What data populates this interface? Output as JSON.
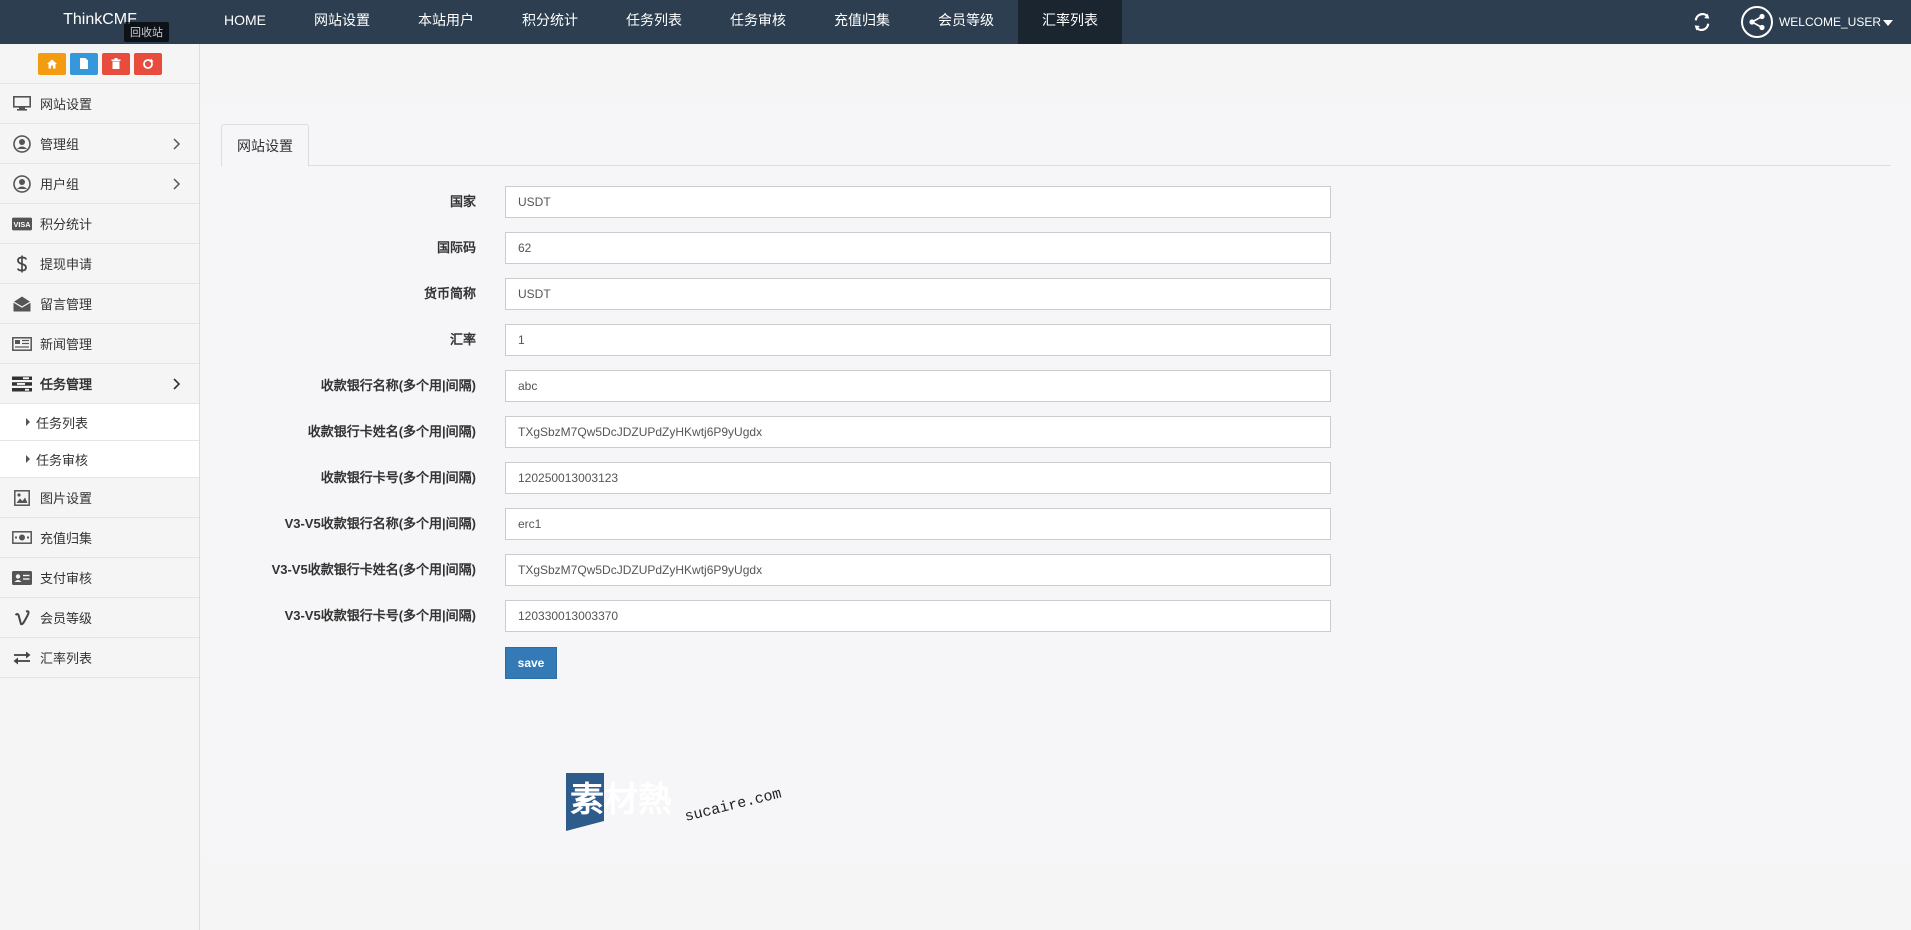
{
  "brand": "ThinkCMF",
  "nav": {
    "items": [
      "HOME",
      "网站设置",
      "本站用户",
      "积分统计",
      "任务列表",
      "任务审核",
      "充值归集",
      "会员等级",
      "汇率列表"
    ],
    "active_index": 8,
    "welcome": "WELCOME_USER"
  },
  "shortcuts": {
    "tooltip": "回收站"
  },
  "sidebar": {
    "items": [
      {
        "label": "网站设置",
        "icon": "monitor-icon"
      },
      {
        "label": "管理组",
        "icon": "user-circle-icon",
        "has_children": true
      },
      {
        "label": "用户组",
        "icon": "user-icon",
        "has_children": true
      },
      {
        "label": "积分统计",
        "icon": "visa-card-icon"
      },
      {
        "label": "提现申请",
        "icon": "dollar-icon"
      },
      {
        "label": "留言管理",
        "icon": "envelope-icon"
      },
      {
        "label": "新闻管理",
        "icon": "newspaper-icon"
      },
      {
        "label": "任务管理",
        "icon": "tasks-icon",
        "has_children": true,
        "expanded": true
      },
      {
        "label": "图片设置",
        "icon": "image-icon"
      },
      {
        "label": "充值归集",
        "icon": "money-icon"
      },
      {
        "label": "支付审核",
        "icon": "id-card-icon"
      },
      {
        "label": "会员等级",
        "icon": "vimeo-icon"
      },
      {
        "label": "汇率列表",
        "icon": "exchange-icon"
      }
    ],
    "sub_items": [
      "任务列表",
      "任务审核"
    ]
  },
  "main": {
    "tab": "网站设置",
    "fields": [
      {
        "label": "国家",
        "value": "USDT"
      },
      {
        "label": "国际码",
        "value": "62"
      },
      {
        "label": "货币简称",
        "value": "USDT"
      },
      {
        "label": "汇率",
        "value": "1"
      },
      {
        "label": "收款银行名称(多个用|间隔)",
        "value": "abc"
      },
      {
        "label": "收款银行卡姓名(多个用|间隔)",
        "value": "TXgSbzM7Qw5DcJDZUPdZyHKwtj6P9yUgdx"
      },
      {
        "label": "收款银行卡号(多个用|间隔)",
        "value": "120250013003123"
      },
      {
        "label": "V3-V5收款银行名称(多个用|间隔)",
        "value": "erc1"
      },
      {
        "label": "V3-V5收款银行卡姓名(多个用|间隔)",
        "value": "TXgSbzM7Qw5DcJDZUPdZyHKwtj6P9yUgdx"
      },
      {
        "label": "V3-V5收款银行卡号(多个用|间隔)",
        "value": "120330013003370"
      }
    ],
    "save_label": "save"
  },
  "watermark": {
    "logo_text": "素材熱",
    "domain": "sucaire.com"
  },
  "colors": {
    "navbar": "#2c3e50",
    "nav_active": "#1a252f",
    "primary_button": "#337ab7",
    "home_shortcut": "#f39c12",
    "doc_shortcut": "#3498db",
    "danger_shortcut": "#e74c3c"
  }
}
